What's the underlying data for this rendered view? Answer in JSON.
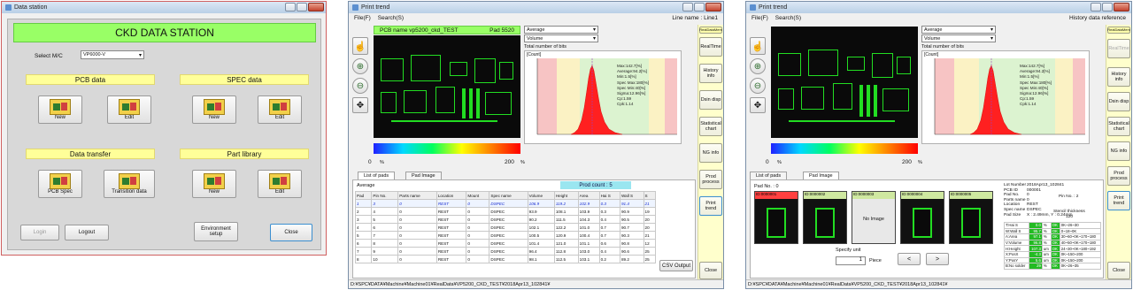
{
  "w1": {
    "title": "Data station",
    "header": "CKD DATA STATION",
    "select_label": "Select M/C",
    "select_value": "VP6000-V",
    "sections": {
      "pcb": "PCB data",
      "spec": "SPEC data",
      "transfer": "Data transfer",
      "part": "Part library"
    },
    "buttons": {
      "pcb_new": "New",
      "pcb_edit": "Edit",
      "spec_new": "New",
      "spec_edit": "Edit",
      "pcb_spec": "PCB Spec",
      "transition": "Transition data",
      "part_new": "New",
      "part_edit": "Edit"
    },
    "bottom": {
      "login": "Login",
      "logout": "Logout",
      "env": "Environment setup",
      "close": "Close"
    }
  },
  "w2": {
    "title": "Print trend",
    "menu": {
      "file": "File(F)",
      "search": "Search(S)"
    },
    "line_name": "Line  name : Line1",
    "pcb_name": "PCB name  vp5200_ckd_TEST",
    "pad": "Pad  5520",
    "sel_average": "Average",
    "sel_volume": "Volume",
    "total_bits": "Total number of bits",
    "count_label": "[Count]",
    "stats": [
      "Max:142.7[%]",
      "Average:94.2[%]",
      "Min:1.5[%]",
      "Spec Max:180[%]",
      "Spec Min:40[%]",
      "Sigma:12.96[%]",
      "Cp:1.59",
      "Cpk:1.14"
    ],
    "scale_left": "0",
    "scale_right": "200",
    "scale_unit": "%",
    "side": {
      "realtime_tag": "RealDataMem",
      "realtime": "RealTime",
      "history": "History info",
      "dispnum": "Dsin disp",
      "statistical": "Statistical chart",
      "ng": "NG info",
      "prod": "Prod process",
      "trend": "Print trend",
      "close": "Close"
    },
    "tabs": {
      "list": "List of pads",
      "image": "Pad Image"
    },
    "avg_label": "Average",
    "prod_count": "Prod count : 5",
    "cols": [
      "Pad",
      "Pin No.",
      "Parts name",
      "Location",
      "Mount",
      "Spec name",
      "Volume",
      "Height",
      "Area",
      "Hai S",
      "Wall S",
      "S"
    ],
    "avg_row": [
      "1",
      "3",
      "0",
      "REST",
      "0",
      "DSPEC",
      "106.9",
      "119.2",
      "102.9",
      "0.3",
      "91.4",
      "21"
    ],
    "rows": [
      [
        "2",
        "4",
        "0",
        "REST",
        "0",
        "DSPEC",
        "93.9",
        "108.1",
        "103.9",
        "0.3",
        "90.9",
        "19"
      ],
      [
        "3",
        "5",
        "0",
        "REST",
        "0",
        "DSPEC",
        "90.2",
        "111.5",
        "104.3",
        "0.4",
        "90.5",
        "20"
      ],
      [
        "4",
        "6",
        "0",
        "REST",
        "0",
        "DSPEC",
        "102.1",
        "122.2",
        "101.0",
        "0.7",
        "90.7",
        "20"
      ],
      [
        "5",
        "7",
        "0",
        "REST",
        "0",
        "DSPEC",
        "100.5",
        "120.9",
        "100.4",
        "0.7",
        "90.3",
        "21"
      ],
      [
        "6",
        "8",
        "0",
        "REST",
        "0",
        "DSPEC",
        "101.4",
        "121.0",
        "101.1",
        "0.6",
        "90.8",
        "12"
      ],
      [
        "7",
        "9",
        "0",
        "REST",
        "0",
        "DSPEC",
        "96.4",
        "112.8",
        "103.0",
        "0.4",
        "90.6",
        "25"
      ],
      [
        "8",
        "10",
        "0",
        "REST",
        "0",
        "DSPEC",
        "98.1",
        "112.5",
        "103.1",
        "0.2",
        "89.2",
        "25"
      ]
    ],
    "csv": "CSV Output",
    "status": "D:¥SPC¥DATA¥Machine¥Machine01¥RealData¥VP5200_CKD_TEST¥2018Apr13_102841¥"
  },
  "w3": {
    "title": "Print trend",
    "menu": {
      "file": "File(F)",
      "search": "Search(S)"
    },
    "right_title": "History data reference",
    "sel_average": "Average",
    "sel_volume": "Volume",
    "total_bits": "Total number of bits",
    "count_label": "[Count]",
    "stats": [
      "Max:142.7[%]",
      "Average:94.2[%]",
      "Min:1.5[%]",
      "Spec Max:180[%]",
      "Spec Min:40[%]",
      "Sigma:12.96[%]",
      "Cp:1.59",
      "Cpk:1.14"
    ],
    "scale_left": "0",
    "scale_right": "200",
    "scale_unit": "%",
    "side": {
      "realtime_tag": "RealDataMem",
      "realtime": "RealTime",
      "history": "History info",
      "dispnum": "Dsin disp",
      "statistical": "Statistical chart",
      "ng": "NG info",
      "prod": "Prod process",
      "trend": "Print trend",
      "close": "Close"
    },
    "tabs": {
      "list": "List of pads",
      "image": "Pad Image"
    },
    "pad_no": "Pad No. : 0",
    "thumbs": [
      "ID:0000001",
      "ID:0000002",
      "ID:0000003",
      "ID:0000004",
      "ID:0000005"
    ],
    "no_image": "No Image",
    "specify": "Specify unit",
    "piece_val": "1",
    "piece_label": "Piece",
    "info": [
      [
        "Lot Number",
        "2018Apr13_102841"
      ],
      [
        "PCB ID",
        "000001"
      ],
      [
        "Pad No.",
        "0"
      ],
      [
        "Parts name",
        "0"
      ],
      [
        "Location",
        "REST"
      ],
      [
        "Spec name",
        "DSPEC"
      ],
      [
        "Pad Size",
        "X : 2.49mm, Y : 0.24mm"
      ]
    ],
    "pin_no": "Pin No. :   2",
    "stencil": "Stencil thickness",
    "stencil_val": "120",
    "meas": [
      [
        "T:Hai S",
        "0.0",
        "%",
        "OK",
        "0K~26~30"
      ],
      [
        "W:Wall S",
        "95.7",
        "%",
        "OK",
        "0~18~0K"
      ],
      [
        "A:Area",
        "97.1",
        "%",
        "OK",
        "30~60~0K~170~180"
      ],
      [
        "V:Volume",
        "96.8",
        "%",
        "OK",
        "40~50~0K~170~180"
      ],
      [
        "H:Height",
        "107.3",
        "um",
        "OK",
        "24~30~0K~180~192"
      ],
      [
        "X:PosX",
        "-4.3",
        "um",
        "OK",
        "0K~150~200"
      ],
      [
        "Y:PosY",
        "5.6",
        "um",
        "OK",
        "0K~150~200"
      ],
      [
        "B:No solder",
        "29",
        "%",
        "OK",
        "0K~26~35"
      ]
    ],
    "status": "D:¥SPC¥DATA¥Machine¥Machine01¥RealData¥VP5200_CKD_TEST¥2018Apr13_102841¥"
  }
}
